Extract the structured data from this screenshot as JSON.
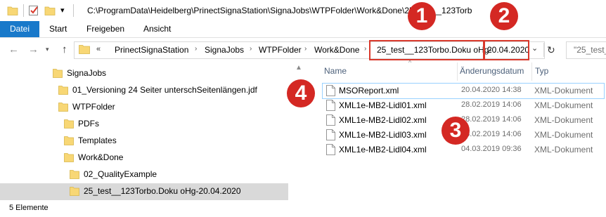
{
  "window": {
    "title": "C:\\ProgramData\\Heidelberg\\PrinectSignaStation\\SignaJobs\\WTPFolder\\Work&Done\\25_test__123Torb",
    "quick_access_dropdown": "▾"
  },
  "ribbon": {
    "tabs": [
      "Datei",
      "Start",
      "Freigeben",
      "Ansicht"
    ]
  },
  "addressbar": {
    "overflow": "«",
    "crumbs": [
      "PrinectSignaStation",
      "SignaJobs",
      "WTPFolder",
      "Work&Done",
      "25_test__123Torbo.Doku oHg-",
      "20.04.2020"
    ],
    "separator": "›"
  },
  "search": {
    "text": "\"25_test_"
  },
  "tree": [
    {
      "label": "SignaJobs"
    },
    {
      "label": "01_Versioning 24 Seiter unterschSeitenlängen.jdf"
    },
    {
      "label": "WTPFolder"
    },
    {
      "label": "PDFs"
    },
    {
      "label": "Templates"
    },
    {
      "label": "Work&Done"
    },
    {
      "label": "02_QualityExample"
    },
    {
      "label": "25_test__123Torbo.Doku oHg-20.04.2020"
    }
  ],
  "columns": {
    "name": "Name",
    "date": "Änderungsdatum",
    "type": "Typ"
  },
  "files": [
    {
      "name": "MSOReport.xml",
      "date": "20.04.2020 14:38",
      "type": "XML-Dokument"
    },
    {
      "name": "XML1e-MB2-Lidl01.xml",
      "date": "28.02.2019 14:06",
      "type": "XML-Dokument"
    },
    {
      "name": "XML1e-MB2-Lidl02.xml",
      "date": "28.02.2019 14:06",
      "type": "XML-Dokument"
    },
    {
      "name": "XML1e-MB2-Lidl03.xml",
      "date": "28.02.2019 14:06",
      "type": "XML-Dokument"
    },
    {
      "name": "XML1e-MB2-Lidl04.xml",
      "date": "04.03.2019 09:36",
      "type": "XML-Dokument"
    }
  ],
  "status": {
    "text": "5 Elemente"
  },
  "annotations": [
    "1",
    "2",
    "3",
    "4"
  ],
  "colors": {
    "accent": "#1979ca",
    "annotation_red": "#d42823",
    "folder": "#f8d775",
    "selection": "#d9d9d9"
  }
}
